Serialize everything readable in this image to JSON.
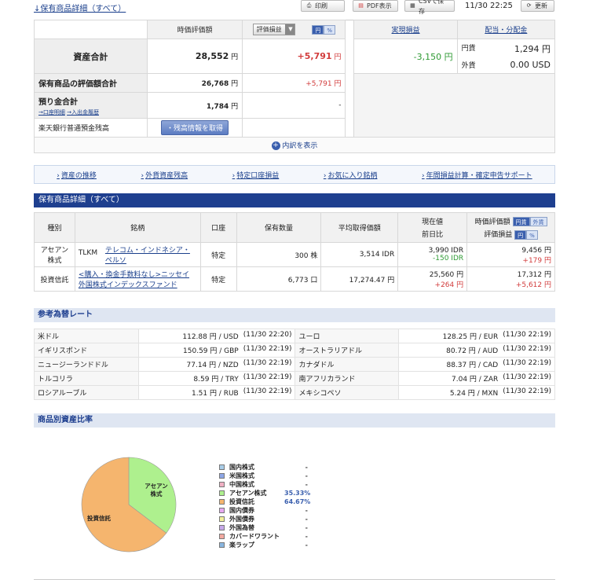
{
  "header": {
    "title_link": "↓保有商品詳細（すべて）",
    "print_label": "印刷",
    "pdf_label": "PDF表示",
    "csv_label": "CSVで保存",
    "timestamp": "11/30 22:25",
    "refresh_label": "更新"
  },
  "summary": {
    "col_valuation": "時価評価額",
    "col_pl_select": "評価損益",
    "seg_yen": "円",
    "seg_pct": "%",
    "col_realized": "実現損益",
    "col_dividend": "配当・分配金",
    "total_label": "資産合計",
    "total_value": "28,552",
    "total_unit": "円",
    "total_pl": "+5,791",
    "total_pl_unit": "円",
    "realized_value": "-3,150",
    "realized_unit": "円",
    "div_yen_label": "円貨",
    "div_yen_value": "1,294 円",
    "div_fx_label": "外貨",
    "div_fx_value": "0.00 USD",
    "holdings_label": "保有商品の評価額合計",
    "holdings_value": "26,768",
    "holdings_unit": "円",
    "holdings_pl": "+5,791",
    "holdings_pl_unit": "円",
    "deposit_label": "預り金合計",
    "deposit_link1": "→口座明細",
    "deposit_link2": "→入出金履歴",
    "deposit_value": "1,784",
    "deposit_unit": "円",
    "deposit_pl": "-",
    "bank_label": "楽天銀行普通預金残高",
    "bank_button": "・残高情報を取得",
    "breakdown_label": "内訳を表示"
  },
  "nav": [
    "資産の推移",
    "外貨資産残高",
    "特定口座損益",
    "お気に入り銘柄",
    "年間損益計算・確定申告サポート"
  ],
  "holdings": {
    "section_title": "保有商品詳細（すべて）",
    "headers": {
      "type": "種別",
      "name": "銘柄",
      "account": "口座",
      "qty": "保有数量",
      "avg": "平均取得価額",
      "price": "現在値",
      "change": "前日比",
      "valuation": "時価評価額",
      "pl": "評価損益",
      "seg_yen": "円貨",
      "seg_fx": "外貨",
      "seg_yen2": "円",
      "seg_pct": "%"
    },
    "rows": [
      {
        "type1": "アセアン",
        "type2": "株式",
        "code": "TLKM",
        "name1": "テレコム・インドネシア・",
        "name2": "ペルソ",
        "account": "特定",
        "qty": "300 株",
        "avg": "3,514 IDR",
        "price": "3,990 IDR",
        "change": "-150 IDR",
        "valuation": "9,456 円",
        "pl": "+179 円"
      },
      {
        "type1": "投資信託",
        "type2": "",
        "code": "",
        "name1": "<購入・換金手数料なし>ニッセイ",
        "name2": "外国株式インデックスファンド",
        "account": "特定",
        "qty": "6,773 口",
        "avg": "17,274.47 円",
        "price": "25,560 円",
        "change": "+264 円",
        "valuation": "17,312 円",
        "pl": "+5,612 円"
      }
    ]
  },
  "fx": {
    "section_title": "参考為替レート",
    "rows": [
      [
        {
          "name": "米ドル",
          "rate": "112.88 円 / USD",
          "time": "(11/30  22:20)"
        },
        {
          "name": "ユーロ",
          "rate": "128.25 円 / EUR",
          "time": "(11/30  22:19)"
        }
      ],
      [
        {
          "name": "イギリスポンド",
          "rate": "150.59 円 / GBP",
          "time": "(11/30  22:19)"
        },
        {
          "name": "オーストラリアドル",
          "rate": "80.72 円 / AUD",
          "time": "(11/30  22:19)"
        }
      ],
      [
        {
          "name": "ニュージーランドドル",
          "rate": "77.14 円 / NZD",
          "time": "(11/30  22:19)"
        },
        {
          "name": "カナダドル",
          "rate": "88.37 円 / CAD",
          "time": "(11/30  22:19)"
        }
      ],
      [
        {
          "name": "トルコリラ",
          "rate": "8.59 円 / TRY",
          "time": "(11/30  22:19)"
        },
        {
          "name": "南アフリカランド",
          "rate": "7.04 円 / ZAR",
          "time": "(11/30  22:19)"
        }
      ],
      [
        {
          "name": "ロシアルーブル",
          "rate": "1.51 円 / RUB",
          "time": "(11/30  22:19)"
        },
        {
          "name": "メキシコペソ",
          "rate": "5.24 円 / MXN",
          "time": "(11/30  22:19)"
        }
      ]
    ]
  },
  "allocation": {
    "section_title": "商品別資産比率",
    "pie_label_asean1": "アセアン",
    "pie_label_asean2": "株式",
    "pie_label_fund": "投資信託",
    "legend": [
      {
        "name": "国内株式",
        "pct": "-",
        "color": "#a9cde8"
      },
      {
        "name": "米国株式",
        "pct": "-",
        "color": "#8da6e6"
      },
      {
        "name": "中国株式",
        "pct": "-",
        "color": "#f0b1c4"
      },
      {
        "name": "アセアン株式",
        "pct": "35.33%",
        "color": "#aef08e"
      },
      {
        "name": "投資信託",
        "pct": "64.67%",
        "color": "#f5b56e"
      },
      {
        "name": "国内債券",
        "pct": "-",
        "color": "#e6a8f0"
      },
      {
        "name": "外国債券",
        "pct": "-",
        "color": "#f3f09a"
      },
      {
        "name": "外国為替",
        "pct": "-",
        "color": "#c7a9ea"
      },
      {
        "name": "カバードワラント",
        "pct": "-",
        "color": "#f2a9a0"
      },
      {
        "name": "楽ラップ",
        "pct": "-",
        "color": "#8ab6e0"
      }
    ]
  },
  "chart_data": {
    "type": "pie",
    "categories": [
      "アセアン株式",
      "投資信託"
    ],
    "values": [
      35.33,
      64.67
    ],
    "colors": [
      "#aef08e",
      "#f5b56e"
    ]
  }
}
